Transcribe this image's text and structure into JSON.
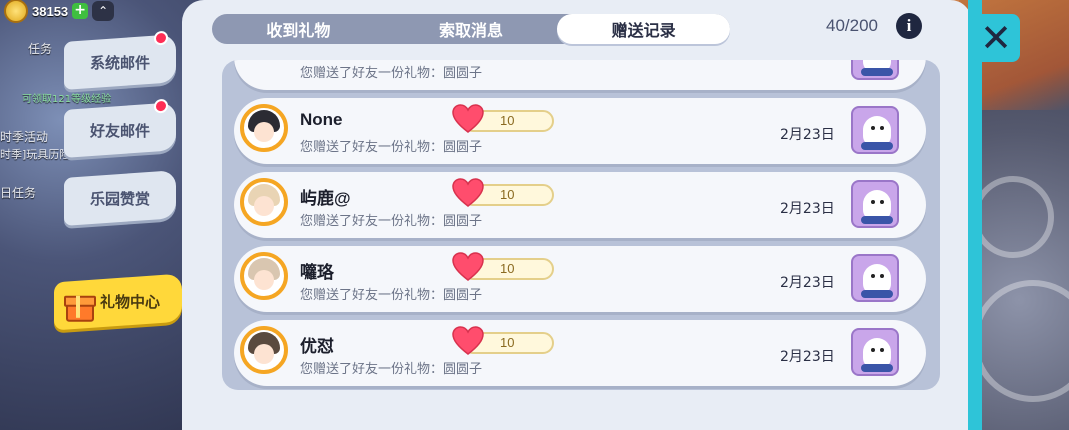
{
  "hud": {
    "coin_count": "38153",
    "plus_symbol": "+",
    "up_symbol": "⌃"
  },
  "background_texts": {
    "task": "任务",
    "exp_hint": "可领取121等级经验",
    "season_activity": "时季活动",
    "season_sub": "时季]玩具历险",
    "daily_task": "日任务"
  },
  "side_tabs": [
    {
      "label": "系统邮件",
      "has_dot": true
    },
    {
      "label": "好友邮件",
      "has_dot": true
    },
    {
      "label": "乐园赞赏",
      "has_dot": false
    }
  ],
  "gift_center": {
    "label": "礼物中心"
  },
  "tabs": [
    {
      "label": "收到礼物",
      "active": false
    },
    {
      "label": "索取消息",
      "active": false
    },
    {
      "label": "赠送记录",
      "active": true
    }
  ],
  "counter": "40/200",
  "info_symbol": "i",
  "close_symbol": "✕",
  "partial_row_desc": "您赠送了好友一份礼物：圆圆子",
  "records": [
    {
      "name": "None",
      "desc": "您赠送了好友一份礼物：圆圆子",
      "hearts": "10",
      "date": "2月23日",
      "gift_icon": "seal-plush-icon"
    },
    {
      "name": "屿鹿@",
      "desc": "您赠送了好友一份礼物：圆圆子",
      "hearts": "10",
      "date": "2月23日",
      "gift_icon": "seal-plush-icon"
    },
    {
      "name": "囖珞",
      "desc": "您赠送了好友一份礼物：圆圆子",
      "hearts": "10",
      "date": "2月23日",
      "gift_icon": "seal-plush-icon"
    },
    {
      "name": "优怼",
      "desc": "您赠送了好友一份礼物：圆圆子",
      "hearts": "10",
      "date": "2月23日",
      "gift_icon": "seal-plush-icon"
    }
  ],
  "colors": {
    "accent_cyan": "#2ec4d8",
    "heart_red": "#ff4d6d",
    "gift_yellow": "#ffd83a",
    "avatar_ring": "#f5a623"
  }
}
